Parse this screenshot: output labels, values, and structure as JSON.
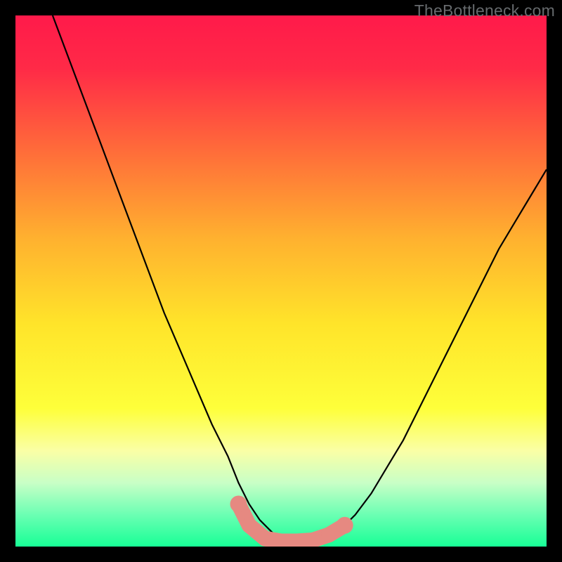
{
  "watermark": "TheBottleneck.com",
  "chart_data": {
    "type": "line",
    "title": "",
    "xlabel": "",
    "ylabel": "",
    "xlim": [
      0,
      100
    ],
    "ylim": [
      0,
      100
    ],
    "background_gradient": {
      "stops": [
        {
          "pos": 0.0,
          "color": "#ff1a4a"
        },
        {
          "pos": 0.1,
          "color": "#ff2a47"
        },
        {
          "pos": 0.25,
          "color": "#ff6a3a"
        },
        {
          "pos": 0.42,
          "color": "#ffb12f"
        },
        {
          "pos": 0.58,
          "color": "#ffe42a"
        },
        {
          "pos": 0.74,
          "color": "#feff3a"
        },
        {
          "pos": 0.82,
          "color": "#faffa6"
        },
        {
          "pos": 0.88,
          "color": "#c8ffc6"
        },
        {
          "pos": 0.94,
          "color": "#6bffb3"
        },
        {
          "pos": 1.0,
          "color": "#18ff96"
        }
      ]
    },
    "series": [
      {
        "name": "bottleneck-curve",
        "color": "#000000",
        "x": [
          7,
          10,
          13,
          16,
          19,
          22,
          25,
          28,
          31,
          34,
          37,
          40,
          42,
          44,
          46,
          48,
          50,
          52,
          54,
          56,
          58,
          61,
          64,
          67,
          70,
          73,
          76,
          79,
          82,
          85,
          88,
          91,
          94,
          97,
          100
        ],
        "y": [
          100,
          92,
          84,
          76,
          68,
          60,
          52,
          44,
          37,
          30,
          23,
          17,
          12,
          8,
          5,
          3,
          1,
          0,
          0,
          0,
          1,
          3,
          6,
          10,
          15,
          20,
          26,
          32,
          38,
          44,
          50,
          56,
          61,
          66,
          71
        ]
      }
    ],
    "markers": {
      "name": "highlight-band",
      "color": "#e68981",
      "points": [
        {
          "x": 42,
          "y": 8
        },
        {
          "x": 44,
          "y": 4
        },
        {
          "x": 47,
          "y": 1.5
        },
        {
          "x": 50,
          "y": 1
        },
        {
          "x": 53,
          "y": 1
        },
        {
          "x": 56,
          "y": 1.2
        },
        {
          "x": 59,
          "y": 2.2
        },
        {
          "x": 62,
          "y": 4
        }
      ]
    }
  }
}
